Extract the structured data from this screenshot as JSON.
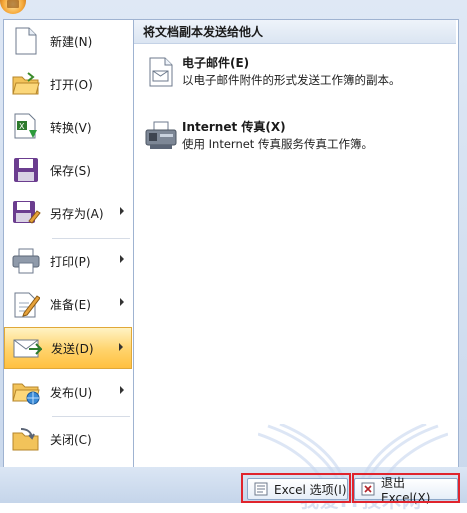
{
  "menu": {
    "items": [
      {
        "label": "新建(N)",
        "icon": "new-document-icon",
        "has_submenu": false
      },
      {
        "label": "打开(O)",
        "icon": "open-folder-icon",
        "has_submenu": false
      },
      {
        "label": "转换(V)",
        "icon": "convert-icon",
        "has_submenu": false
      },
      {
        "label": "保存(S)",
        "icon": "save-disk-icon",
        "has_submenu": false
      },
      {
        "label": "另存为(A)",
        "icon": "save-as-icon",
        "has_submenu": true
      },
      {
        "label": "打印(P)",
        "icon": "printer-icon",
        "has_submenu": true
      },
      {
        "label": "准备(E)",
        "icon": "prepare-pen-icon",
        "has_submenu": true
      },
      {
        "label": "发送(D)",
        "icon": "send-envelope-icon",
        "has_submenu": true,
        "selected": true
      },
      {
        "label": "发布(U)",
        "icon": "publish-icon",
        "has_submenu": true
      },
      {
        "label": "关闭(C)",
        "icon": "close-folder-icon",
        "has_submenu": false
      }
    ]
  },
  "panel": {
    "title": "将文档副本发送给他人",
    "options": [
      {
        "title": "电子邮件(E)",
        "desc": "以电子邮件附件的形式发送工作簿的副本。",
        "icon": "email-document-icon"
      },
      {
        "title": "Internet 传真(X)",
        "desc": "使用 Internet 传真服务传真工作簿。",
        "icon": "fax-machine-icon"
      }
    ]
  },
  "footer": {
    "excel_options_label": "Excel 选项(I)",
    "exit_label": "退出 Excel(X)"
  },
  "watermark": "我爱IT技术网",
  "colors": {
    "selected_bg": "#ffd36b",
    "highlight": "#e0242d",
    "border": "#9fb3d1"
  }
}
